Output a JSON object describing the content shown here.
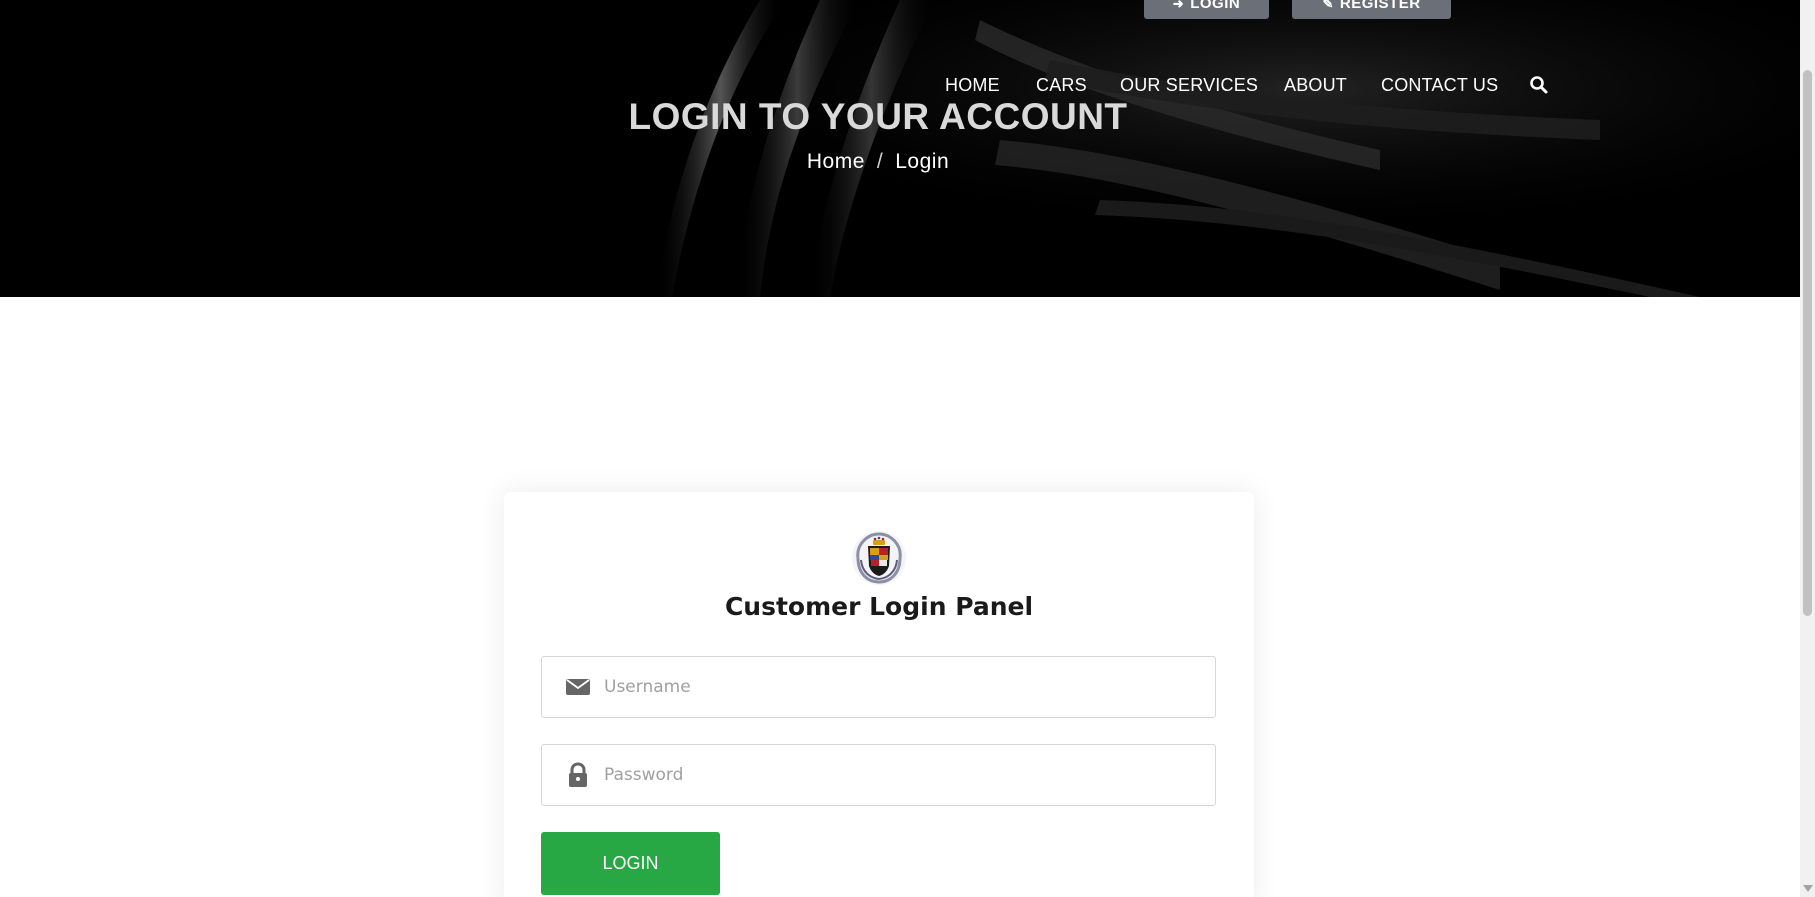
{
  "header": {
    "top_buttons": {
      "login_label": "LOGIN",
      "register_label": "REGISTER"
    },
    "nav": {
      "items": [
        "HOME",
        "CARS",
        "OUR SERVICES",
        "ABOUT",
        "CONTACT US"
      ],
      "search_icon": "search-icon"
    },
    "title": "LOGIN TO YOUR ACCOUNT",
    "breadcrumb": {
      "home": "Home",
      "separator": "/",
      "current": "Login"
    }
  },
  "login_panel": {
    "logo_icon": "cadillac-crest-logo",
    "title": "Customer Login Panel",
    "username": {
      "placeholder": "Username",
      "value": "",
      "icon": "envelope-icon"
    },
    "password": {
      "placeholder": "Password",
      "value": "",
      "icon": "lock-icon"
    },
    "submit_label": "LOGIN"
  },
  "colors": {
    "hero_bg": "#000000",
    "top_button_bg": "#6b7078",
    "login_button_bg": "#28a745",
    "title_text": "#d9d9d9"
  }
}
